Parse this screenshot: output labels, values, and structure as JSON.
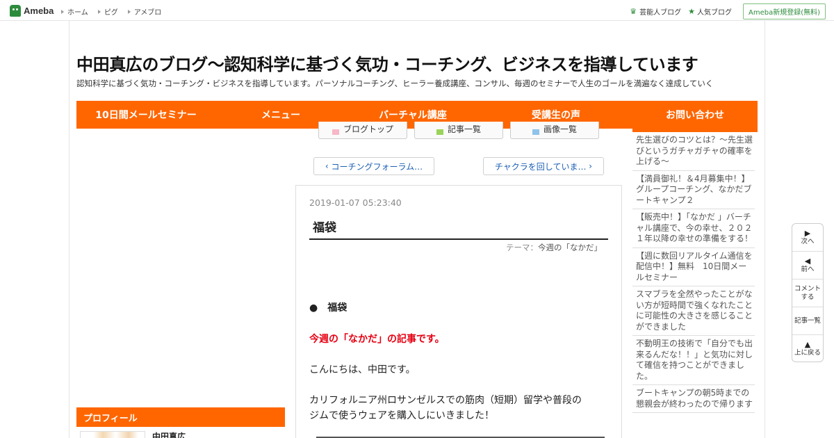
{
  "topbar": {
    "logo_text": "Ameba",
    "nav": [
      "ホーム",
      "ピグ",
      "アメブロ"
    ],
    "celebrity_blog": "芸能人ブログ",
    "popular_blog": "人気ブログ",
    "register": "Ameba新規登録(無料)"
  },
  "blog": {
    "title": "中田真広のブログ〜認知科学に基づく気功・コーチング、ビジネスを指導しています",
    "description": "認知科学に基づく気功・コーチング・ビジネスを指導しています。パーソナルコーチング、ヒーラー養成講座、コンサル、毎週のセミナーで人生のゴールを満遍なく達成していく"
  },
  "nav": [
    "10日間メールセミナー",
    "メニュー",
    "バーチャル講座",
    "受講生の声",
    "お問い合わせ"
  ],
  "toolbar": {
    "top": "ブログトップ",
    "entries": "記事一覧",
    "images": "画像一覧"
  },
  "pager": {
    "prev": "コーチングフォーラム…",
    "next": "チャクラを回していま…"
  },
  "article": {
    "date": "2019-01-07 05:23:40",
    "title": "福袋",
    "theme_label": "テーマ：",
    "theme_value": "今週の「なかだ」",
    "bullet": "●　福袋",
    "lead": "今週の「なかだ」の記事です。",
    "greeting": "こんにちは、中田です。",
    "para1": "カリフォルニア州ロサンゼルスでの筋肉（短期）留学や普段の",
    "para2": "ジムで使うウェアを購入しにいきました！"
  },
  "sidebar": {
    "profile_heading": "プロフィール",
    "profile_name": "中田真広",
    "entries": [
      "先生選びのコツとは？～先生選びというガチャガチャの確率を上げる～",
      "【満員御礼！＆4月募集中！】グループコーチング、なかだブートキャンプ２",
      "【販売中！】「なかだ 」バーチャル講座で、今の幸せ、２０２１年以降の幸せの準備をする！",
      "【週に数回リアルタイム通信を配信中！】無料　10日間メールセミナー",
      "スマブラを全然やったことがない方が短時間で強くなれたことに可能性の大きさを感じることができました",
      "不動明王の技術で「自分でも出来るんだな！！」と気功に対して確信を持つことができました。",
      "ブートキャンプの朝5時までの懇親会が終わったので帰ります"
    ]
  },
  "float": {
    "next": "次へ",
    "prev": "前へ",
    "comment1": "コメント",
    "comment2": "する",
    "list": "記事一覧",
    "top": "上に戻る"
  }
}
